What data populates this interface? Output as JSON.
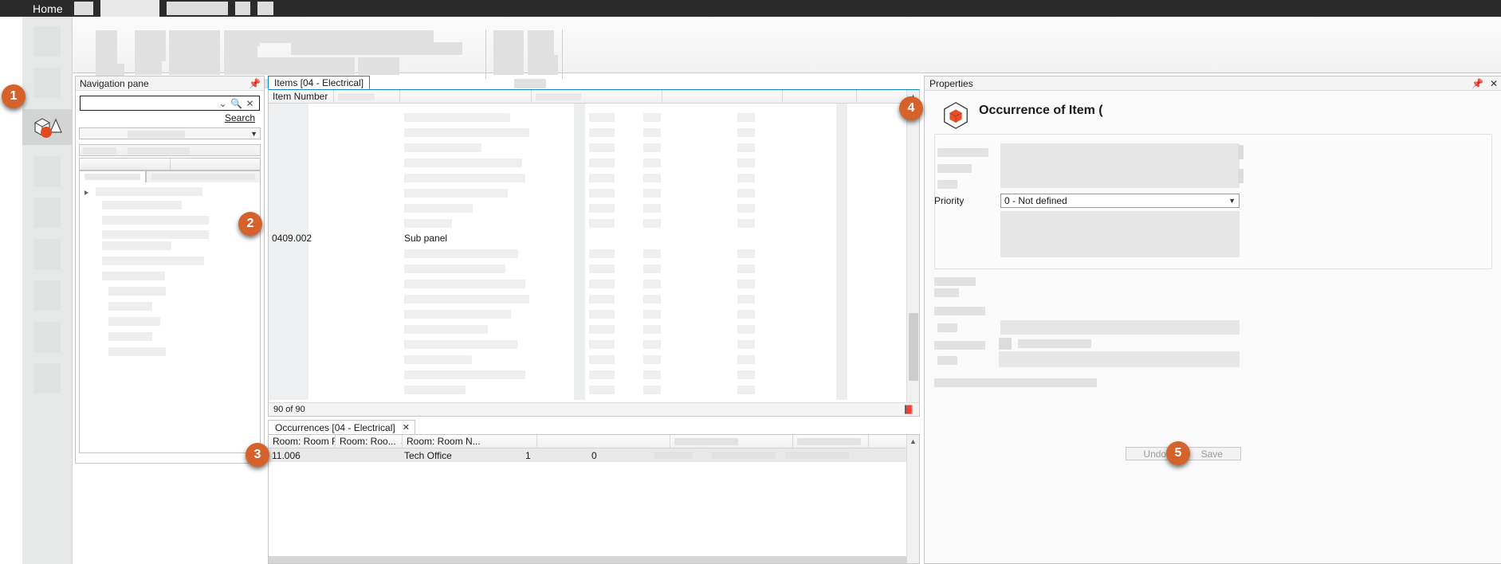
{
  "window": {
    "title_tab": "Home",
    "ribbon_tabs": [
      "",
      "",
      "",
      "",
      ""
    ]
  },
  "rail": {
    "icon_name": "shapes-3d-icon",
    "slots": 8
  },
  "navigation": {
    "title": "Navigation pane",
    "pin_icon": "pin-icon",
    "search_value": "",
    "search_placeholder": "",
    "dropdown_icon": "chevron-down-icon",
    "search_icon": "search-icon",
    "clear_icon": "clear-icon",
    "search_link": "Search"
  },
  "items": {
    "tab_label": "Items [04 - Electrical]",
    "columns": [
      "Item Number",
      "",
      "",
      "",
      "",
      ""
    ],
    "selected_row": {
      "item_number": "0409.002",
      "description": "Sub panel"
    },
    "status_count": "90 of 90",
    "status_icon": "book-icon",
    "scroll_up_icon": "chevron-up-icon",
    "scroll_down_icon": "chevron-down-icon"
  },
  "occurrences": {
    "tab_label": "Occurrences [04 - Electrical]",
    "close_icon": "close-icon",
    "columns": [
      "Room: Room Fu...",
      "Room: Roo...",
      "Room: Room N...",
      "",
      "",
      "",
      ""
    ],
    "sort_icon": "sort-ascending-icon",
    "row": {
      "number": "11.006",
      "name": "Tech Office",
      "value_1": "1",
      "value_2": "0"
    }
  },
  "properties": {
    "title": "Properties",
    "pin_icon": "pin-icon",
    "close_icon": "close-icon",
    "heading": "Occurrence of Item (",
    "heading_icon": "cube-icon",
    "priority_label": "Priority",
    "priority_value": "0 - Not defined",
    "priority_caret": "chevron-down-icon",
    "undo_label": "Undo",
    "save_label": "Save"
  },
  "callouts": [
    {
      "id": "1",
      "label": "1"
    },
    {
      "id": "2",
      "label": "2"
    },
    {
      "id": "3",
      "label": "3"
    },
    {
      "id": "4",
      "label": "4"
    },
    {
      "id": "5",
      "label": "5"
    }
  ],
  "colors": {
    "accent": "#d4622a",
    "tab_active_border": "#0a87c4",
    "titlebar": "#2b2b2b"
  }
}
